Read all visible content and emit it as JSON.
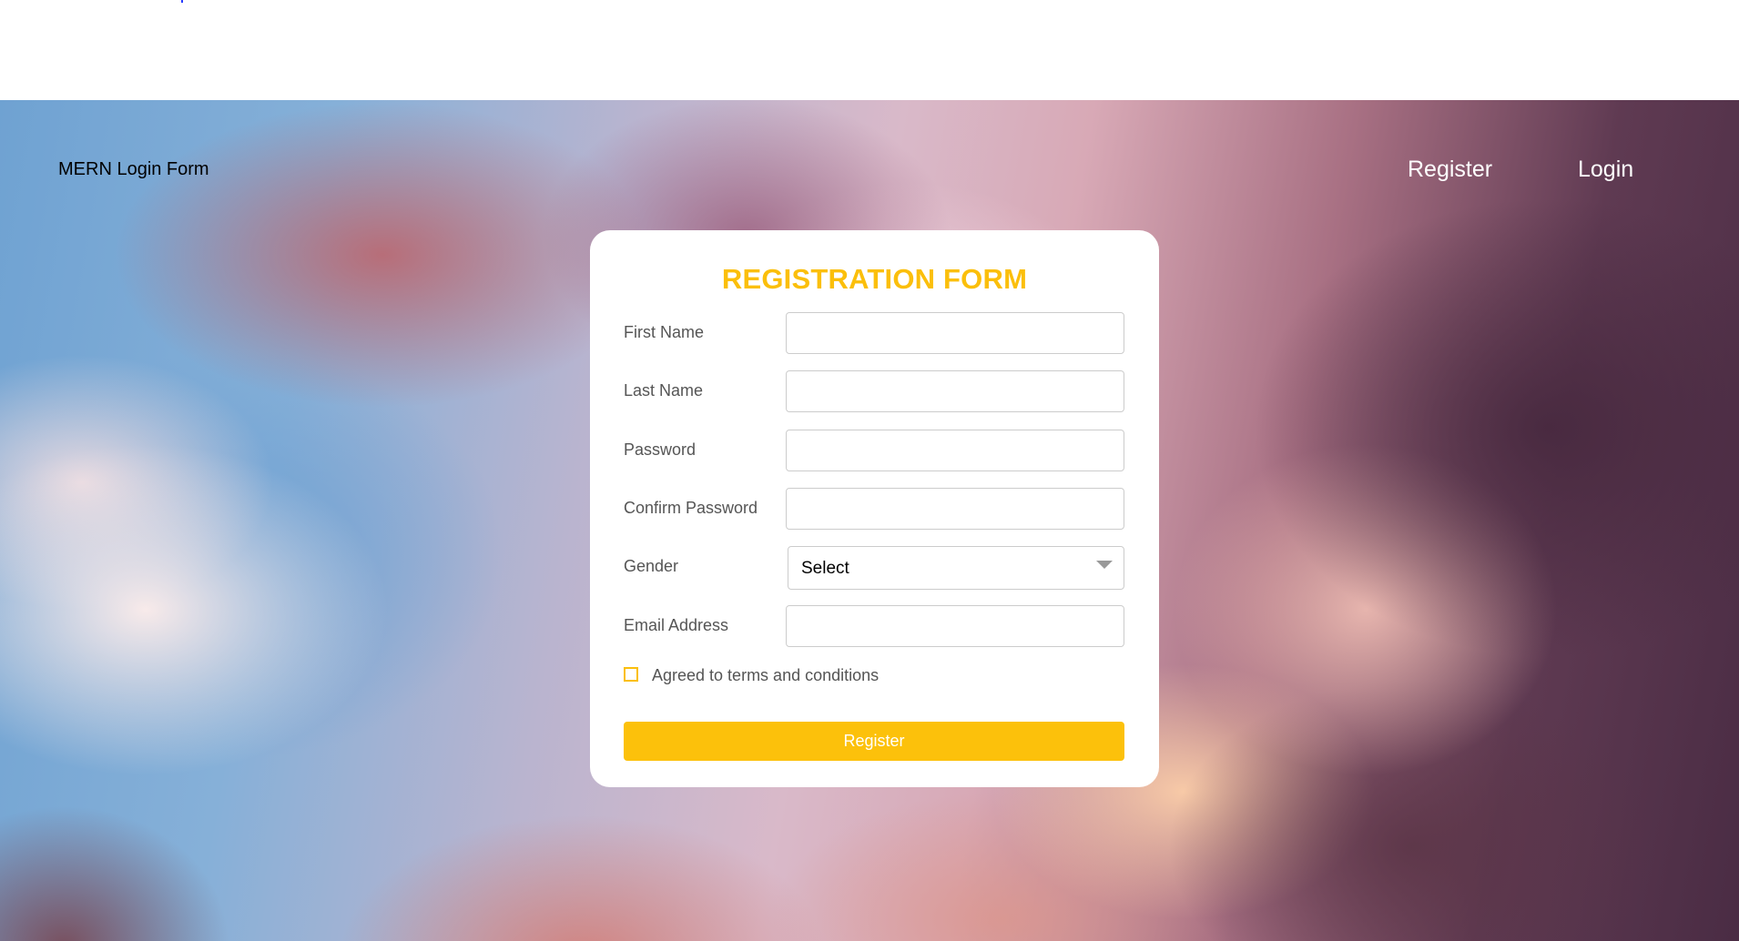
{
  "navbar": {
    "brand": "MERN Login Form",
    "links": [
      {
        "label": "Register"
      },
      {
        "label": "Login"
      }
    ]
  },
  "form": {
    "title": "REGISTRATION FORM",
    "fields": [
      {
        "label": "First Name",
        "value": ""
      },
      {
        "label": "Last Name",
        "value": ""
      },
      {
        "label": "Password",
        "value": ""
      },
      {
        "label": "Confirm Password",
        "value": ""
      },
      {
        "label": "Gender",
        "selected": "Select"
      },
      {
        "label": "Email Address",
        "value": ""
      }
    ],
    "terms_label": "Agreed to terms and conditions",
    "terms_checked": false,
    "submit_label": "Register"
  },
  "colors": {
    "accent": "#fbbf0b",
    "nav_link": "#ffffff",
    "label_text": "#555555"
  },
  "icons": [
    "chevron-down-icon",
    "checkbox"
  ]
}
